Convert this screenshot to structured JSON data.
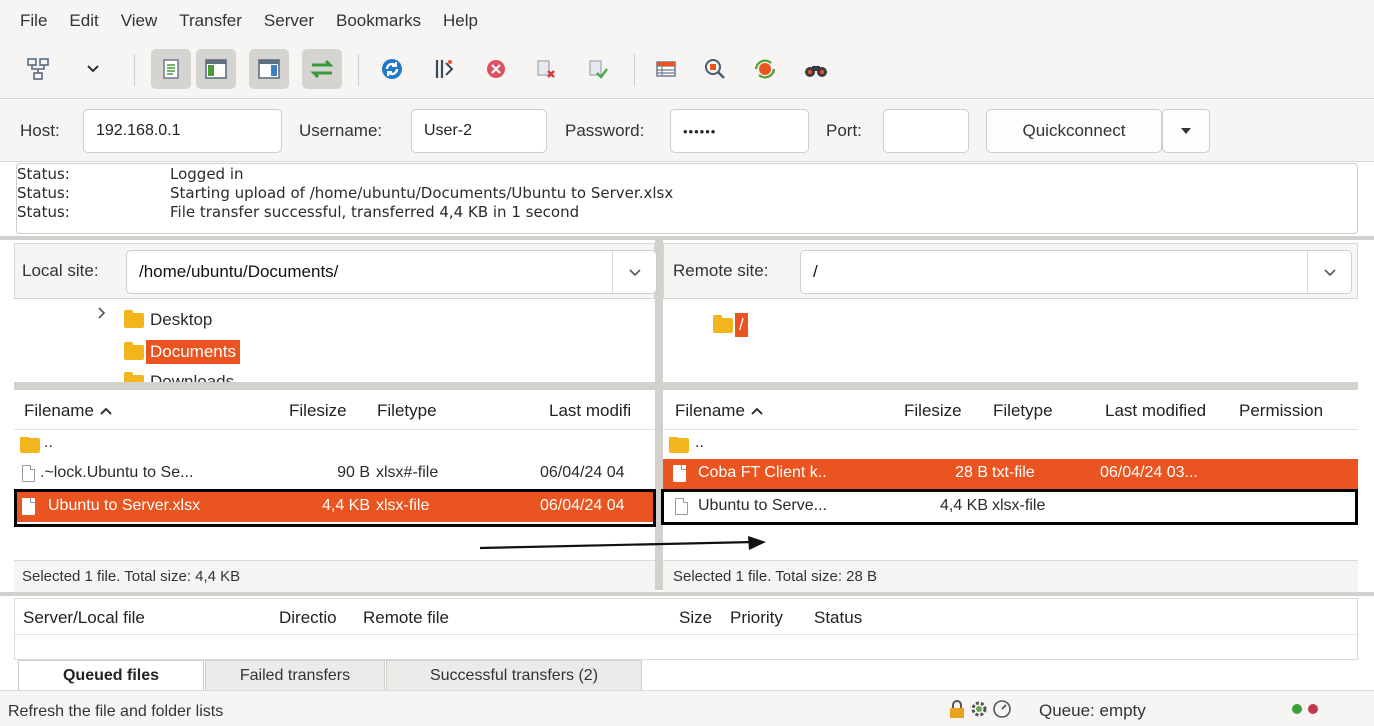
{
  "menu": [
    "File",
    "Edit",
    "View",
    "Transfer",
    "Server",
    "Bookmarks",
    "Help"
  ],
  "toolbar": {
    "icons": [
      "site-manager-icon",
      "dropdown-chevron-icon",
      "toggle-message-log-icon",
      "toggle-local-tree-icon",
      "toggle-remote-tree-icon",
      "toggle-transfer-queue-icon",
      "refresh-icon",
      "process-queue-icon",
      "cancel-icon",
      "disconnect-icon",
      "reconnect-icon",
      "directory-listing-filters-icon",
      "toggle-directory-comparison-icon",
      "synchronized-browsing-icon",
      "search-remote-files-icon"
    ]
  },
  "quickconnect": {
    "host_label": "Host:",
    "host_value": "192.168.0.1",
    "username_label": "Username:",
    "username_value": "User-2",
    "password_label": "Password:",
    "password_value": "••••••",
    "port_label": "Port:",
    "port_value": "",
    "button_label": "Quickconnect"
  },
  "log": [
    {
      "key": "Status:",
      "text": "Logged in"
    },
    {
      "key": "Status:",
      "text": "Starting upload of /home/ubuntu/Documents/Ubuntu to Server.xlsx"
    },
    {
      "key": "Status:",
      "text": "File transfer successful, transferred 4,4 KB in 1 second"
    }
  ],
  "local": {
    "site_label": "Local site:",
    "site_path": "/home/ubuntu/Documents/",
    "tree": [
      "Desktop",
      "Documents",
      "Downloads"
    ],
    "headers": {
      "filename": "Filename",
      "filesize": "Filesize",
      "filetype": "Filetype",
      "modified": "Last modifi"
    },
    "files": [
      {
        "name": "..",
        "size": "",
        "type": "",
        "modified": ""
      },
      {
        "name": ".~lock.Ubuntu to Se...",
        "size": "90 B",
        "type": "xlsx#-file",
        "modified": "06/04/24 04"
      },
      {
        "name": "Ubuntu to Server.xlsx",
        "size": "4,4 KB",
        "type": "xlsx-file",
        "modified": "06/04/24 04"
      }
    ],
    "status": "Selected 1 file. Total size: 4,4 KB"
  },
  "remote": {
    "site_label": "Remote site:",
    "site_path": "/",
    "tree_root": "/",
    "headers": {
      "filename": "Filename",
      "filesize": "Filesize",
      "filetype": "Filetype",
      "modified": "Last modified",
      "permissions": "Permission"
    },
    "files": [
      {
        "name": "..",
        "size": "",
        "type": "",
        "modified": ""
      },
      {
        "name": "Coba FT Client k..",
        "size": "28 B",
        "type": "txt-file",
        "modified": "06/04/24 03..."
      },
      {
        "name": "Ubuntu to Serve...",
        "size": "4,4 KB",
        "type": "xlsx-file",
        "modified": ""
      }
    ],
    "status": "Selected 1 file. Total size: 28 B"
  },
  "queue": {
    "headers": {
      "server_local": "Server/Local file",
      "direction": "Directio",
      "remote_file": "Remote file",
      "size": "Size",
      "priority": "Priority",
      "status": "Status"
    },
    "tabs": [
      "Queued files",
      "Failed transfers",
      "Successful transfers (2)"
    ]
  },
  "statusbar": {
    "hint": "Refresh the file and folder lists",
    "queue": "Queue: empty"
  },
  "colors": {
    "accent": "#e95420",
    "folder": "#f2b61c",
    "toolbar_bg": "#f6f5f4"
  }
}
